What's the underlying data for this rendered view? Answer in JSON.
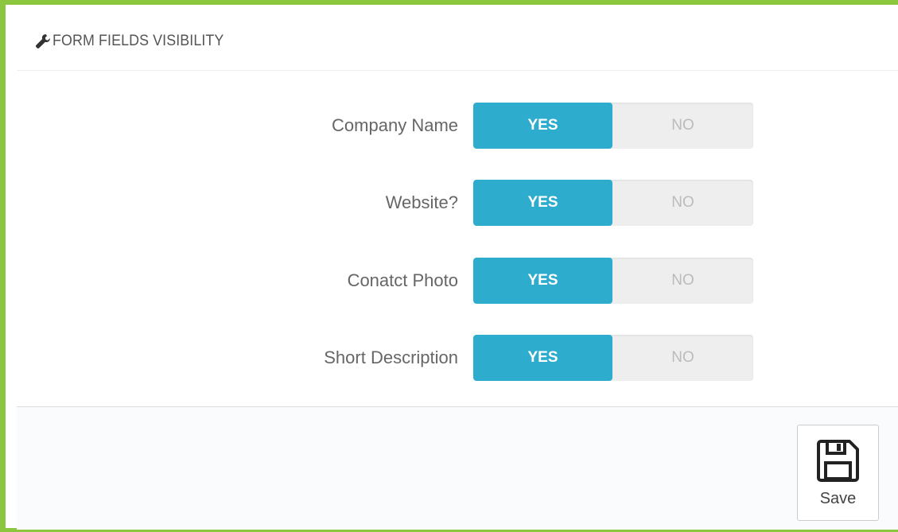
{
  "panel": {
    "title": "FORM FIELDS VISIBILITY",
    "title_icon": "wrench-icon"
  },
  "fields": [
    {
      "label": "Company Name",
      "yes_label": "YES",
      "no_label": "NO",
      "value": "YES"
    },
    {
      "label": "Website?",
      "yes_label": "YES",
      "no_label": "NO",
      "value": "YES"
    },
    {
      "label": "Conatct Photo",
      "yes_label": "YES",
      "no_label": "NO",
      "value": "YES"
    },
    {
      "label": "Short Description",
      "yes_label": "YES",
      "no_label": "NO",
      "value": "YES"
    }
  ],
  "footer": {
    "save_label": "Save",
    "save_icon": "floppy-disk-icon"
  },
  "colors": {
    "frame_border": "#8cc63f",
    "switch_active": "#2eacce",
    "switch_inactive_bg": "#eeeeee"
  }
}
